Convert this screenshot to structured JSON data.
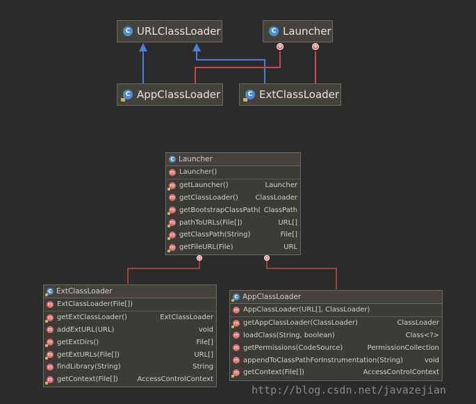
{
  "colors": {
    "extends_line": "#4a7fe0",
    "inner_class_line": "#c54a4a",
    "node_bg": "#44423a",
    "class_icon": "#4a8fd6",
    "method_icon": "#e06c6c"
  },
  "top_diagram": {
    "url_class_loader": "URLClassLoader",
    "launcher": "Launcher",
    "app_class_loader": "AppClassLoader",
    "ext_class_loader": "ExtClassLoader"
  },
  "launcher_box": {
    "title": "Launcher",
    "constructor": "Launcher()",
    "methods": [
      {
        "name": "getLauncher()",
        "type": "Launcher"
      },
      {
        "name": "getClassLoader()",
        "type": "ClassLoader"
      },
      {
        "name": "getBootstrapClassPath()",
        "type": "ClassPath"
      },
      {
        "name": "pathToURLs(File[])",
        "type": "URL[]"
      },
      {
        "name": "getClassPath(String)",
        "type": "File[]"
      },
      {
        "name": "getFileURL(File)",
        "type": "URL"
      }
    ]
  },
  "ext_box": {
    "title": "ExtClassLoader",
    "constructor": "ExtClassLoader(File[])",
    "methods": [
      {
        "name": "getExtClassLoader()",
        "type": "ExtClassLoader"
      },
      {
        "name": "addExtURL(URL)",
        "type": "void"
      },
      {
        "name": "getExtDirs()",
        "type": "File[]"
      },
      {
        "name": "getExtURLs(File[])",
        "type": "URL[]"
      },
      {
        "name": "findLibrary(String)",
        "type": "String"
      },
      {
        "name": "getContext(File[])",
        "type": "AccessControlContext"
      }
    ]
  },
  "app_box": {
    "title": "AppClassLoader",
    "constructor": "AppClassLoader(URL[], ClassLoader)",
    "methods": [
      {
        "name": "getAppClassLoader(ClassLoader)",
        "type": "ClassLoader"
      },
      {
        "name": "loadClass(String, boolean)",
        "type": "Class<?>"
      },
      {
        "name": "getPermissions(CodeSource)",
        "type": "PermissionCollection"
      },
      {
        "name": "appendToClassPathForInstrumentation(String)",
        "type": "void"
      },
      {
        "name": "getContext(File[])",
        "type": "AccessControlContext"
      }
    ]
  },
  "watermark": "http://blog.csdn.net/javazejian"
}
